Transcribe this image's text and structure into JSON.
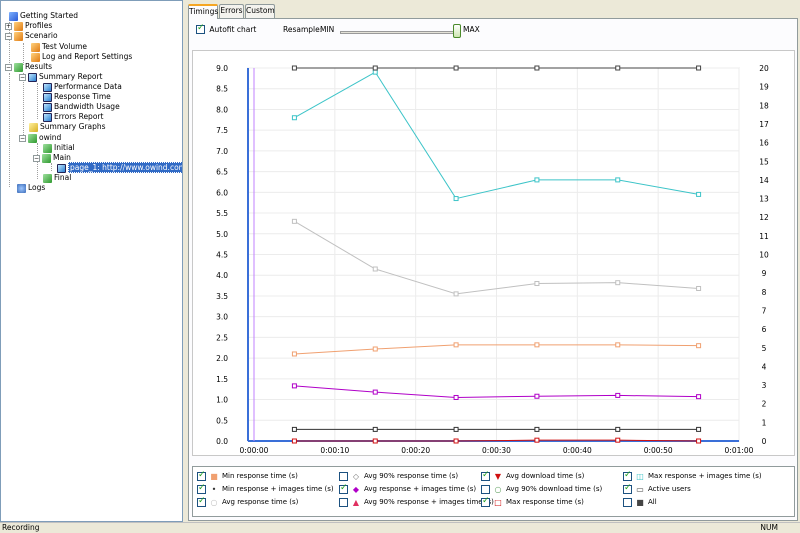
{
  "tree": {
    "items": [
      {
        "label": "Getting Started",
        "icon": "getting-started-icon"
      },
      {
        "label": "Profiles",
        "icon": "profiles-icon"
      },
      {
        "label": "Scenario",
        "icon": "scenario-icon"
      },
      {
        "label": "Test Volume",
        "icon": "test-volume-icon"
      },
      {
        "label": "Log and Report Settings",
        "icon": "settings-icon"
      },
      {
        "label": "Results",
        "icon": "results-icon"
      },
      {
        "label": "Summary Report",
        "icon": "report-icon"
      },
      {
        "label": "Performance Data",
        "icon": "report-icon"
      },
      {
        "label": "Response Time",
        "icon": "report-icon"
      },
      {
        "label": "Bandwidth Usage",
        "icon": "report-icon"
      },
      {
        "label": "Errors Report",
        "icon": "report-icon"
      },
      {
        "label": "Summary Graphs",
        "icon": "graphs-icon"
      },
      {
        "label": "owind",
        "icon": "folder-icon"
      },
      {
        "label": "Initial",
        "icon": "page-icon"
      },
      {
        "label": "Main",
        "icon": "page-icon"
      },
      {
        "label": "page_1: http://www.owind.com/",
        "icon": "chart-icon"
      },
      {
        "label": "Final",
        "icon": "page-icon"
      },
      {
        "label": "Logs",
        "icon": "logs-icon"
      }
    ]
  },
  "tabs": [
    "Timings",
    "Errors",
    "Custom"
  ],
  "toolbar": {
    "autofit_label": "Autofit chart",
    "autofit_checked": true,
    "resample_label": "Resample:",
    "min_label": "MIN",
    "max_label": "MAX",
    "resample_value": 1.0
  },
  "chart_data": {
    "type": "line",
    "x": [
      "0:00:05",
      "0:00:15",
      "0:00:25",
      "0:00:35",
      "0:00:45",
      "0:00:55"
    ],
    "x_ticks": [
      "0:00:00",
      "0:00:10",
      "0:00:20",
      "0:00:30",
      "0:00:40",
      "0:00:50",
      "0:01:00"
    ],
    "y_left_ticks": [
      "0.0",
      "0.5",
      "1.0",
      "1.5",
      "2.0",
      "2.5",
      "3.0",
      "3.5",
      "4.0",
      "4.5",
      "5.0",
      "5.5",
      "6.0",
      "6.5",
      "7.0",
      "7.5",
      "8.0",
      "8.5",
      "9.0"
    ],
    "y_right_ticks": [
      "0",
      "1",
      "2",
      "3",
      "4",
      "5",
      "6",
      "7",
      "8",
      "9",
      "10",
      "11",
      "12",
      "13",
      "14",
      "15",
      "16",
      "17",
      "18",
      "19",
      "20"
    ],
    "ylim_left": [
      0,
      9
    ],
    "ylim_right": [
      0,
      20
    ],
    "series": [
      {
        "name": "Max response + images time (s)",
        "axis": "left",
        "color": "#3cc4c8",
        "values": [
          7.8,
          8.9,
          5.85,
          6.3,
          6.3,
          5.95
        ]
      },
      {
        "name": "Avg response + images time (s)",
        "axis": "left",
        "color": "#b000c8",
        "values": [
          1.33,
          1.18,
          1.05,
          1.08,
          1.1,
          1.07
        ]
      },
      {
        "name": "Avg response time (s)",
        "axis": "left",
        "color": "#f0a070",
        "values": [
          2.1,
          2.22,
          2.32,
          2.32,
          2.32,
          2.3
        ]
      },
      {
        "name": "Max response time (s)",
        "axis": "left",
        "color": "#c0c0c0",
        "values": [
          5.3,
          4.15,
          3.55,
          3.8,
          3.82,
          3.68
        ]
      },
      {
        "name": "Min response + images time (s)",
        "axis": "left",
        "color": "#333333",
        "values": [
          0.28,
          0.28,
          0.28,
          0.28,
          0.28,
          0.28
        ]
      },
      {
        "name": "Avg download time (s)",
        "axis": "left",
        "color": "#d01010",
        "values": [
          0.0,
          0.0,
          0.0,
          0.02,
          0.02,
          0.0
        ]
      },
      {
        "name": "Active users",
        "axis": "right",
        "color": "#444444",
        "values": [
          20,
          20,
          20,
          20,
          20,
          20
        ]
      }
    ]
  },
  "legend": {
    "items": [
      {
        "label": "Min response time (s)",
        "checked": true,
        "symbol": "■",
        "color": "#f0a070"
      },
      {
        "label": "Avg 90% response time (s)",
        "checked": false,
        "symbol": "◇",
        "color": "#777777"
      },
      {
        "label": "Avg download time (s)",
        "checked": true,
        "symbol": "▼",
        "color": "#d01010"
      },
      {
        "label": "Max response + images time (s)",
        "checked": true,
        "symbol": "◫",
        "color": "#3cc4c8"
      },
      {
        "label": "Min response + images time (s)",
        "checked": true,
        "symbol": "•",
        "color": "#333333"
      },
      {
        "label": "Avg response + images time (s)",
        "checked": true,
        "symbol": "◆",
        "color": "#b000c8"
      },
      {
        "label": "Avg 90% download time (s)",
        "checked": false,
        "symbol": "○",
        "color": "#60a060"
      },
      {
        "label": "Active users",
        "checked": true,
        "symbol": "▭",
        "color": "#444444"
      },
      {
        "label": "Avg response time (s)",
        "checked": true,
        "symbol": "○",
        "color": "#c0c0c0"
      },
      {
        "label": "Avg 90% response + images time (s)",
        "checked": false,
        "symbol": "▲",
        "color": "#e03060"
      },
      {
        "label": "Max response time (s)",
        "checked": true,
        "symbol": "□",
        "color": "#d01010"
      },
      {
        "label": "All",
        "checked": false,
        "symbol": "■",
        "color": "#444444"
      }
    ]
  },
  "status": {
    "left": "Recording",
    "right": "NUM"
  }
}
